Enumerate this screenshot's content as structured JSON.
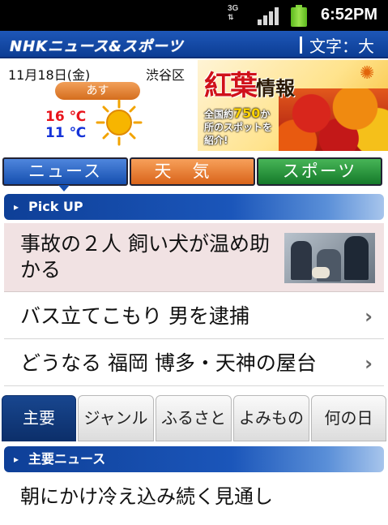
{
  "status_bar": {
    "network": "3G",
    "time": "6:52PM"
  },
  "header": {
    "logo": "NHKニュース&スポーツ",
    "font_size_label": "文字：大"
  },
  "weather": {
    "date": "11月18日(金)",
    "location": "渋谷区",
    "day_badge": "あす",
    "high": "16 ℃",
    "low": "11 ℃",
    "condition_icon": "sun-icon"
  },
  "ad": {
    "title_main": "紅葉",
    "title_sub": "情報",
    "line1_pre": "全国約",
    "line1_num": "750",
    "line1_post": "か",
    "line2": "所のスポットを",
    "line3": "紹介!"
  },
  "main_tabs": {
    "news": "ニュース",
    "weather": "天気",
    "sports": "スポーツ"
  },
  "pickup": {
    "header": "Pick UP",
    "featured": "事故の２人 飼い犬が温め助かる",
    "items": [
      "バス立てこもり 男を逮捕",
      "どうなる 福岡 博多・天神の屋台"
    ]
  },
  "sub_tabs": [
    "主要",
    "ジャンル",
    "ふるさと",
    "よみもの",
    "何の日"
  ],
  "main_news": {
    "header": "主要ニュース",
    "items": [
      "朝にかけ冷え込み続く見通し"
    ]
  },
  "colors": {
    "brand_blue": "#0c3d94",
    "weather_orange": "#d9641a",
    "sports_green": "#157a2a",
    "temp_high": "#e8141c",
    "temp_low": "#1432d8"
  }
}
